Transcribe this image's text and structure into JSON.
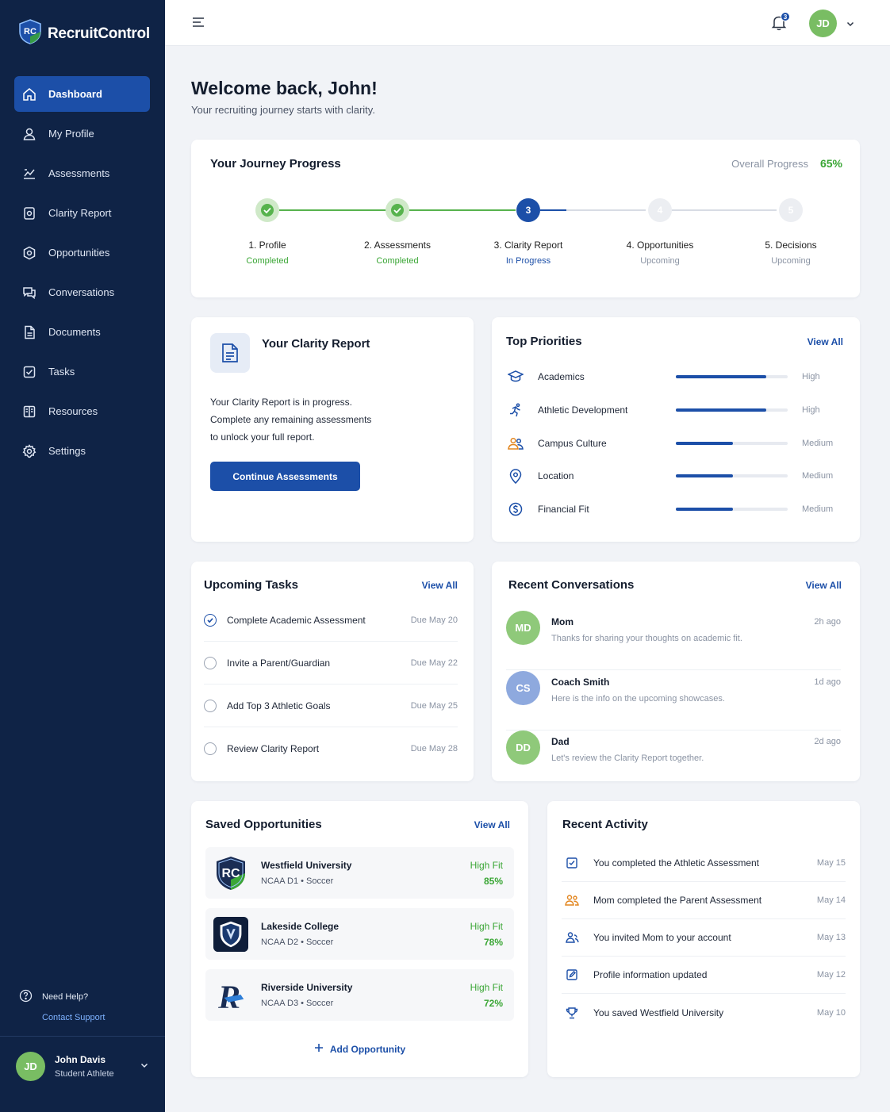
{
  "app": {
    "name": "RecruitControl",
    "logo_text": "RC"
  },
  "colors": {
    "primary": "#1c4fa8",
    "sidebar": "#0f2346",
    "success": "#3aa635",
    "avatar_green": "#79bd63",
    "avatar_blue": "#7f9fd6"
  },
  "sidebar": {
    "items": [
      {
        "label": "Dashboard",
        "icon": "home-icon"
      },
      {
        "label": "My Profile",
        "icon": "user-icon"
      },
      {
        "label": "Assessments",
        "icon": "chart-icon"
      },
      {
        "label": "Clarity Report",
        "icon": "report-icon"
      },
      {
        "label": "Opportunities",
        "icon": "badge-icon"
      },
      {
        "label": "Conversations",
        "icon": "chat-icon"
      },
      {
        "label": "Documents",
        "icon": "document-icon"
      },
      {
        "label": "Tasks",
        "icon": "checkbox-icon"
      },
      {
        "label": "Resources",
        "icon": "book-icon"
      },
      {
        "label": "Settings",
        "icon": "gear-icon"
      }
    ],
    "help_title": "Need Help?",
    "help_link": "Contact Support",
    "user": {
      "initials": "JD",
      "name": "John Davis",
      "role": "Student Athlete"
    }
  },
  "topbar": {
    "notification_count": "3",
    "user_initials": "JD"
  },
  "welcome": {
    "title": "Welcome back, John!",
    "subtitle": "Your recruiting journey starts with clarity."
  },
  "journey": {
    "title": "Your Journey Progress",
    "overall_label": "Overall Progress",
    "overall_value": "65%",
    "steps": [
      {
        "label": "1. Profile",
        "status": "Completed",
        "state": "done",
        "num": ""
      },
      {
        "label": "2. Assessments",
        "status": "Completed",
        "state": "done",
        "num": ""
      },
      {
        "label": "3. Clarity Report",
        "status": "In Progress",
        "state": "current",
        "num": "3"
      },
      {
        "label": "4. Opportunities",
        "status": "Upcoming",
        "state": "upcoming",
        "num": "4"
      },
      {
        "label": "5. Decisions",
        "status": "Upcoming",
        "state": "upcoming",
        "num": "5"
      }
    ]
  },
  "clarity": {
    "title": "Your Clarity Report",
    "line1": "Your Clarity Report is in progress.",
    "line2": "Complete any remaining assessments",
    "line3": "to unlock your full report.",
    "button": "Continue Assessments"
  },
  "priorities": {
    "title": "Top Priorities",
    "view_all": "View All",
    "items": [
      {
        "label": "Academics",
        "level": "High",
        "value": 0.81,
        "icon": "graduation-cap-icon"
      },
      {
        "label": "Athletic Development",
        "level": "High",
        "value": 0.81,
        "icon": "runner-icon"
      },
      {
        "label": "Campus Culture",
        "level": "Medium",
        "value": 0.51,
        "icon": "people-icon"
      },
      {
        "label": "Location",
        "level": "Medium",
        "value": 0.51,
        "icon": "location-pin-icon"
      },
      {
        "label": "Financial Fit",
        "level": "Medium",
        "value": 0.51,
        "icon": "dollar-icon"
      }
    ]
  },
  "tasks": {
    "title": "Upcoming Tasks",
    "view_all": "View All",
    "items": [
      {
        "label": "Complete Academic Assessment",
        "due": "Due May 20",
        "done": true
      },
      {
        "label": "Invite a Parent/Guardian",
        "due": "Due May 22",
        "done": false
      },
      {
        "label": "Add Top 3 Athletic Goals",
        "due": "Due May 25",
        "done": false
      },
      {
        "label": "Review Clarity Report",
        "due": "Due May 28",
        "done": false
      }
    ]
  },
  "conversations": {
    "title": "Recent Conversations",
    "view_all": "View All",
    "items": [
      {
        "initials": "MD",
        "name": "Mom",
        "message": "Thanks for sharing your thoughts on academic fit.",
        "time": "2h ago",
        "color": "#8fc97a"
      },
      {
        "initials": "CS",
        "name": "Coach Smith",
        "message": "Here is the info on the upcoming showcases.",
        "time": "1d ago",
        "color": "#8ea9de"
      },
      {
        "initials": "DD",
        "name": "Dad",
        "message": "Let's review the Clarity Report together.",
        "time": "2d ago",
        "color": "#8fc97a"
      }
    ]
  },
  "opportunities": {
    "title": "Saved Opportunities",
    "view_all": "View All",
    "add_label": "Add Opportunity",
    "items": [
      {
        "name": "Westfield University",
        "meta": "NCAA D1 • Soccer",
        "fit_label": "High Fit",
        "fit": "85%",
        "logo": "RC"
      },
      {
        "name": "Lakeside College",
        "meta": "NCAA D2 • Soccer",
        "fit_label": "High Fit",
        "fit": "78%",
        "logo": "shield"
      },
      {
        "name": "Riverside University",
        "meta": "NCAA D3 • Soccer",
        "fit_label": "High Fit",
        "fit": "72%",
        "logo": "R"
      }
    ]
  },
  "activity": {
    "title": "Recent Activity",
    "items": [
      {
        "label": "You completed the Athletic Assessment",
        "date": "May 15",
        "icon": "clipboard-icon"
      },
      {
        "label": "Mom completed the Parent Assessment",
        "date": "May 14",
        "icon": "family-icon"
      },
      {
        "label": "You invited Mom to your account",
        "date": "May 13",
        "icon": "invite-icon"
      },
      {
        "label": "Profile information updated",
        "date": "May 12",
        "icon": "edit-icon"
      },
      {
        "label": "You saved Westfield University",
        "date": "May 10",
        "icon": "trophy-icon"
      }
    ]
  }
}
